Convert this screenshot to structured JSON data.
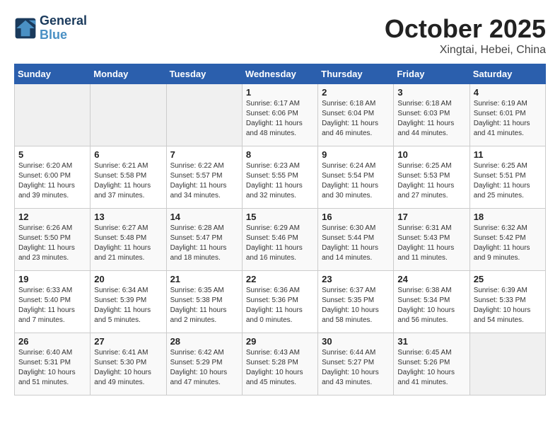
{
  "header": {
    "logo_line1": "General",
    "logo_line2": "Blue",
    "title": "October 2025",
    "subtitle": "Xingtai, Hebei, China"
  },
  "weekdays": [
    "Sunday",
    "Monday",
    "Tuesday",
    "Wednesday",
    "Thursday",
    "Friday",
    "Saturday"
  ],
  "weeks": [
    [
      {
        "day": "",
        "info": ""
      },
      {
        "day": "",
        "info": ""
      },
      {
        "day": "",
        "info": ""
      },
      {
        "day": "1",
        "info": "Sunrise: 6:17 AM\nSunset: 6:06 PM\nDaylight: 11 hours\nand 48 minutes."
      },
      {
        "day": "2",
        "info": "Sunrise: 6:18 AM\nSunset: 6:04 PM\nDaylight: 11 hours\nand 46 minutes."
      },
      {
        "day": "3",
        "info": "Sunrise: 6:18 AM\nSunset: 6:03 PM\nDaylight: 11 hours\nand 44 minutes."
      },
      {
        "day": "4",
        "info": "Sunrise: 6:19 AM\nSunset: 6:01 PM\nDaylight: 11 hours\nand 41 minutes."
      }
    ],
    [
      {
        "day": "5",
        "info": "Sunrise: 6:20 AM\nSunset: 6:00 PM\nDaylight: 11 hours\nand 39 minutes."
      },
      {
        "day": "6",
        "info": "Sunrise: 6:21 AM\nSunset: 5:58 PM\nDaylight: 11 hours\nand 37 minutes."
      },
      {
        "day": "7",
        "info": "Sunrise: 6:22 AM\nSunset: 5:57 PM\nDaylight: 11 hours\nand 34 minutes."
      },
      {
        "day": "8",
        "info": "Sunrise: 6:23 AM\nSunset: 5:55 PM\nDaylight: 11 hours\nand 32 minutes."
      },
      {
        "day": "9",
        "info": "Sunrise: 6:24 AM\nSunset: 5:54 PM\nDaylight: 11 hours\nand 30 minutes."
      },
      {
        "day": "10",
        "info": "Sunrise: 6:25 AM\nSunset: 5:53 PM\nDaylight: 11 hours\nand 27 minutes."
      },
      {
        "day": "11",
        "info": "Sunrise: 6:25 AM\nSunset: 5:51 PM\nDaylight: 11 hours\nand 25 minutes."
      }
    ],
    [
      {
        "day": "12",
        "info": "Sunrise: 6:26 AM\nSunset: 5:50 PM\nDaylight: 11 hours\nand 23 minutes."
      },
      {
        "day": "13",
        "info": "Sunrise: 6:27 AM\nSunset: 5:48 PM\nDaylight: 11 hours\nand 21 minutes."
      },
      {
        "day": "14",
        "info": "Sunrise: 6:28 AM\nSunset: 5:47 PM\nDaylight: 11 hours\nand 18 minutes."
      },
      {
        "day": "15",
        "info": "Sunrise: 6:29 AM\nSunset: 5:46 PM\nDaylight: 11 hours\nand 16 minutes."
      },
      {
        "day": "16",
        "info": "Sunrise: 6:30 AM\nSunset: 5:44 PM\nDaylight: 11 hours\nand 14 minutes."
      },
      {
        "day": "17",
        "info": "Sunrise: 6:31 AM\nSunset: 5:43 PM\nDaylight: 11 hours\nand 11 minutes."
      },
      {
        "day": "18",
        "info": "Sunrise: 6:32 AM\nSunset: 5:42 PM\nDaylight: 11 hours\nand 9 minutes."
      }
    ],
    [
      {
        "day": "19",
        "info": "Sunrise: 6:33 AM\nSunset: 5:40 PM\nDaylight: 11 hours\nand 7 minutes."
      },
      {
        "day": "20",
        "info": "Sunrise: 6:34 AM\nSunset: 5:39 PM\nDaylight: 11 hours\nand 5 minutes."
      },
      {
        "day": "21",
        "info": "Sunrise: 6:35 AM\nSunset: 5:38 PM\nDaylight: 11 hours\nand 2 minutes."
      },
      {
        "day": "22",
        "info": "Sunrise: 6:36 AM\nSunset: 5:36 PM\nDaylight: 11 hours\nand 0 minutes."
      },
      {
        "day": "23",
        "info": "Sunrise: 6:37 AM\nSunset: 5:35 PM\nDaylight: 10 hours\nand 58 minutes."
      },
      {
        "day": "24",
        "info": "Sunrise: 6:38 AM\nSunset: 5:34 PM\nDaylight: 10 hours\nand 56 minutes."
      },
      {
        "day": "25",
        "info": "Sunrise: 6:39 AM\nSunset: 5:33 PM\nDaylight: 10 hours\nand 54 minutes."
      }
    ],
    [
      {
        "day": "26",
        "info": "Sunrise: 6:40 AM\nSunset: 5:31 PM\nDaylight: 10 hours\nand 51 minutes."
      },
      {
        "day": "27",
        "info": "Sunrise: 6:41 AM\nSunset: 5:30 PM\nDaylight: 10 hours\nand 49 minutes."
      },
      {
        "day": "28",
        "info": "Sunrise: 6:42 AM\nSunset: 5:29 PM\nDaylight: 10 hours\nand 47 minutes."
      },
      {
        "day": "29",
        "info": "Sunrise: 6:43 AM\nSunset: 5:28 PM\nDaylight: 10 hours\nand 45 minutes."
      },
      {
        "day": "30",
        "info": "Sunrise: 6:44 AM\nSunset: 5:27 PM\nDaylight: 10 hours\nand 43 minutes."
      },
      {
        "day": "31",
        "info": "Sunrise: 6:45 AM\nSunset: 5:26 PM\nDaylight: 10 hours\nand 41 minutes."
      },
      {
        "day": "",
        "info": ""
      }
    ]
  ]
}
